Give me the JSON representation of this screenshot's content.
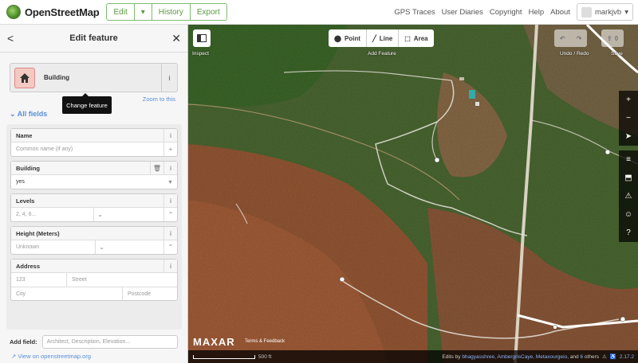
{
  "topbar": {
    "logo_text": "OpenStreetMap",
    "edit_label": "Edit",
    "edit_dropdown_icon": "▾",
    "history_label": "History",
    "export_label": "Export",
    "nav": [
      "GPS Traces",
      "User Diaries",
      "Copyright",
      "Help",
      "About"
    ],
    "username": "markjvb",
    "user_dropdown_icon": "▾"
  },
  "sidebar": {
    "back_icon": "<",
    "title": "Edit feature",
    "close_icon": "✕",
    "preset_name": "Building",
    "preset_info_icon": "i",
    "tooltip": "Change feature",
    "zoom_link": "Zoom to this",
    "all_fields_label": "All fields",
    "fields": {
      "name": {
        "label": "Name",
        "placeholder": "Common name (if any)",
        "action": "+"
      },
      "building": {
        "label": "Building",
        "value": "yes",
        "action": "▾"
      },
      "levels": {
        "label": "Levels",
        "placeholder": "2, 4, 6..."
      },
      "height": {
        "label": "Height (Meters)",
        "placeholder": "Unknown"
      },
      "address": {
        "label": "Address",
        "housenumber": "123",
        "street": "Street",
        "city": "City",
        "postcode": "Postcode"
      }
    },
    "add_field_label": "Add field:",
    "add_field_placeholder": "Architect, Description, Elevation...",
    "osm_link": "View on openstreetmap.org"
  },
  "map": {
    "modes": {
      "inspect_label": "Inspect",
      "point": "Point",
      "line": "Line",
      "area": "Area",
      "add_feature_label": "Add Feature"
    },
    "undo_redo_label": "Undo / Redo",
    "save_label": "Save",
    "save_count": "0",
    "rail_icons": [
      "+",
      "−",
      "➤",
      "≡",
      "⬒",
      "⚠",
      "☺",
      "?"
    ],
    "brand": "MAXAR",
    "terms": "Terms & Feedback",
    "scale_label": "500 ft",
    "credits_prefix": "Edits by",
    "credits_names": "bhagyasshree, AmbergrisCaye, Metaxourgeio,",
    "credits_suffix": "and",
    "credits_count": "6",
    "credits_others": "others",
    "version": "2.17.2"
  },
  "colors": {
    "accent": "#7ebc6f",
    "link": "#5a8fd8"
  }
}
